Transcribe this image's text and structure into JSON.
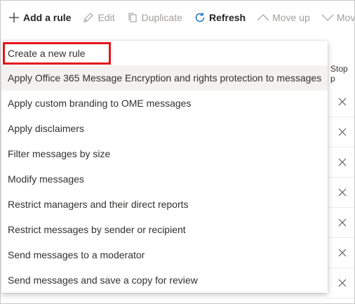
{
  "toolbar": {
    "add_rule": "Add a rule",
    "edit": "Edit",
    "duplicate": "Duplicate",
    "refresh": "Refresh",
    "move_up": "Move up",
    "move_down": "Move"
  },
  "table": {
    "column_stop": "Stop p"
  },
  "menu": {
    "items": [
      {
        "label": "Create a new rule"
      },
      {
        "label": "Apply Office 365 Message Encryption and rights protection to messages"
      },
      {
        "label": "Apply custom branding to OME messages"
      },
      {
        "label": "Apply disclaimers"
      },
      {
        "label": "Filter messages by size"
      },
      {
        "label": "Modify messages"
      },
      {
        "label": "Restrict managers and their direct reports"
      },
      {
        "label": "Restrict messages by sender or recipient"
      },
      {
        "label": "Send messages to a moderator"
      },
      {
        "label": "Send messages and save a copy for review"
      }
    ]
  },
  "colors": {
    "highlight_border": "#e3151c",
    "hover_row": "#f3f2f1",
    "disabled_text": "#a19f9d"
  }
}
